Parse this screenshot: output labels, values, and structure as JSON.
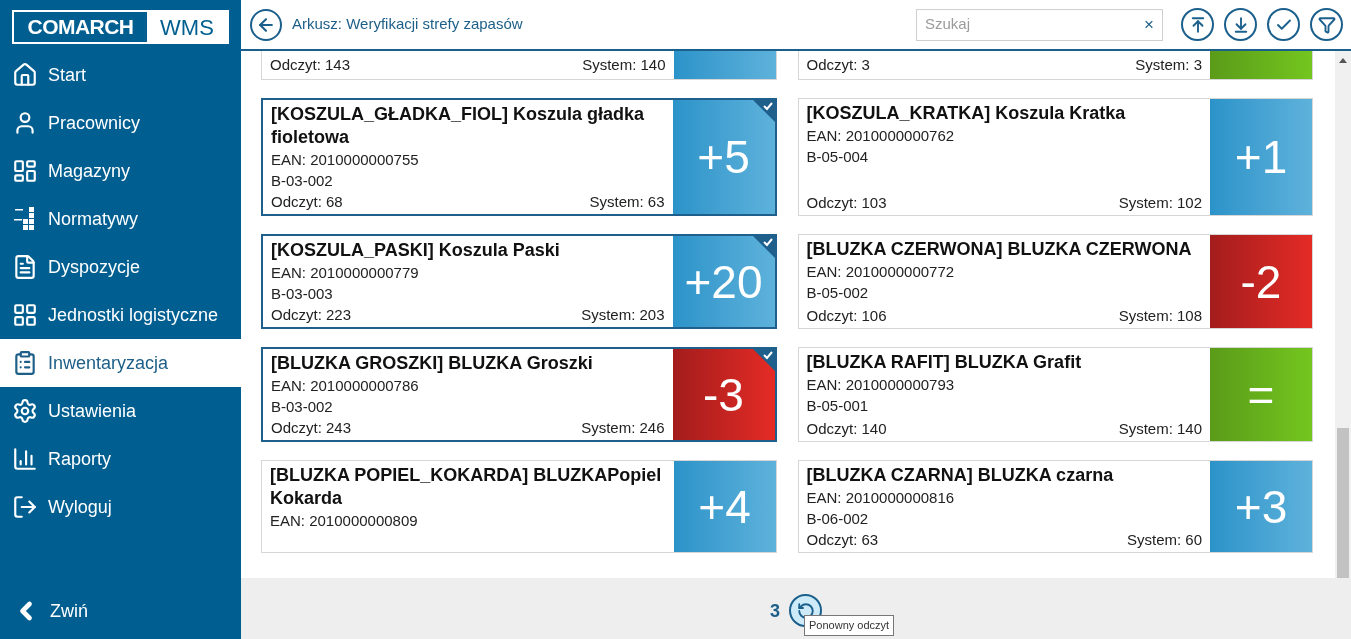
{
  "logo": {
    "brand": "COMARCH",
    "product": "WMS"
  },
  "sidebar": {
    "items": [
      {
        "label": "Start",
        "selected": false
      },
      {
        "label": "Pracownicy",
        "selected": false
      },
      {
        "label": "Magazyny",
        "selected": false
      },
      {
        "label": "Normatywy",
        "selected": false
      },
      {
        "label": "Dyspozycje",
        "selected": false
      },
      {
        "label": "Jednostki logistyczne",
        "selected": false
      },
      {
        "label": "Inwentaryzacja",
        "selected": true
      },
      {
        "label": "Ustawienia",
        "selected": false
      },
      {
        "label": "Raporty",
        "selected": false
      },
      {
        "label": "Wyloguj",
        "selected": false
      }
    ],
    "collapse": {
      "label": "Zwiń"
    }
  },
  "header": {
    "title": "Arkusz: Weryfikacji strefy zapasów",
    "search": {
      "placeholder": "Szukaj",
      "clear": "×"
    }
  },
  "cards": [
    {
      "reading": "Odczyt: 143",
      "system": "System: 140",
      "kind": "surplus",
      "checked": false
    },
    {
      "reading": "Odczyt: 3",
      "system": "System: 3",
      "kind": "equal",
      "checked": false
    },
    {
      "title": "[KOSZULA_GŁADKA_FIOL] Koszula gładka fioletowa",
      "ean": "EAN: 2010000000755",
      "location": "B-03-002",
      "reading": "Odczyt: 68",
      "system": "System: 63",
      "kind": "surplus",
      "diff": "+5",
      "checked": true
    },
    {
      "title": "[KOSZULA_KRATKA] Koszula Kratka",
      "ean": "EAN: 2010000000762",
      "location": "B-05-004",
      "reading": "Odczyt: 103",
      "system": "System: 102",
      "kind": "surplus",
      "diff": "+1",
      "checked": false
    },
    {
      "title": "[KOSZULA_PASKI] Koszula Paski",
      "ean": "EAN: 2010000000779",
      "location": "B-03-003",
      "reading": "Odczyt: 223",
      "system": "System: 203",
      "kind": "surplus",
      "diff": "+20",
      "checked": true
    },
    {
      "title": "[BLUZKA CZERWONA] BLUZKA CZERWONA",
      "ean": "EAN: 2010000000772",
      "location": "B-05-002",
      "reading": "Odczyt: 106",
      "system": "System: 108",
      "kind": "shortage",
      "diff": "-2",
      "checked": false
    },
    {
      "title": "[BLUZKA GROSZKI] BLUZKA Groszki",
      "ean": "EAN: 2010000000786",
      "location": "B-03-002",
      "reading": "Odczyt: 243",
      "system": "System: 246",
      "kind": "shortage",
      "diff": "-3",
      "checked": true
    },
    {
      "title": "[BLUZKA RAFIT] BLUZKA Grafit",
      "ean": "EAN: 2010000000793",
      "location": "B-05-001",
      "reading": "Odczyt: 140",
      "system": "System: 140",
      "kind": "equal",
      "diff": "=",
      "checked": false
    },
    {
      "title": "[BLUZKA POPIEL_KOKARDA] BLUZKAPopiel Kokarda",
      "ean": "EAN: 2010000000809",
      "kind": "surplus",
      "diff": "+4",
      "checked": false
    },
    {
      "title": "[BLUZKA CZARNA] BLUZKA czarna",
      "ean": "EAN: 2010000000816",
      "location": "B-06-002",
      "reading": "Odczyt: 63",
      "system": "System: 60",
      "kind": "surplus",
      "diff": "+3",
      "checked": false
    }
  ],
  "footer": {
    "count": "3",
    "refresh_tooltip": "Ponowny odczyt"
  }
}
